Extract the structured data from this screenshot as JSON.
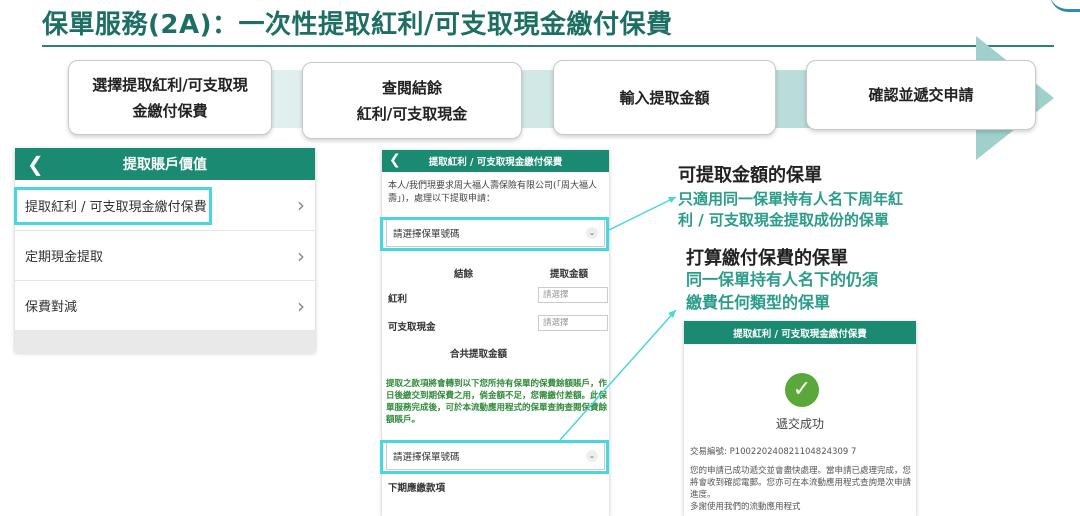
{
  "title": "保單服務(2A)：一次性提取紅利/可支取現金繳付保費",
  "steps": [
    {
      "line1": "選擇提取紅利/可支取現",
      "line2": "金繳付保費"
    },
    {
      "line1": "查閱結餘",
      "line2": "紅利/可支取現金"
    },
    {
      "line1": "輸入提取金額",
      "line2": ""
    },
    {
      "line1": "確認並遞交申請",
      "line2": ""
    }
  ],
  "panel1": {
    "header": "提取賬戶價值",
    "items": [
      "提取紅利 / 可支取現金繳付保費",
      "定期現金提取",
      "保費對減"
    ]
  },
  "panel2": {
    "header": "提取紅利 / 可支取現金繳付保費",
    "intro": "本人/我們現要求周大福人壽保險有限公司(「周大福人壽」)，處理以下提取申請：",
    "policy_select_placeholder": "請選擇保單號碼",
    "col_balance": "結餘",
    "col_amount": "提取金額",
    "row_bonus": "紅利",
    "row_cash": "可支取現金",
    "input_placeholder": "請選擇",
    "total_label": "合共提取金額",
    "note": "提取之款項將會轉到以下您所持有保單的保費餘額賬戶，作日後繳交到期保費之用，倘金額不足，您需繳付差額。此保單服務完成後，可於本流動應用程式的保單查詢查閱保費餘額賬戶。",
    "policy_select2_placeholder": "請選擇保單號碼",
    "next_due": "下期應繳款項"
  },
  "annotation1": {
    "title": "可提取金額的保單",
    "line1": "只適用同一保單持有人名下周年紅",
    "line2": "利 / 可支取現金提取成份的保單"
  },
  "annotation2": {
    "title": "打算繳付保費的保單",
    "line1": "同一保單持有人名下的仍須",
    "line2": "繳費任何類型的保單"
  },
  "panel3": {
    "header": "提取紅利 / 可支取現金繳付保費",
    "success": "遞交成功",
    "txn": "交易編號: P100220240821104824309 7",
    "message": "您的申請已成功遞交並會盡快處理。當申請已處理完成，您將會收到確認電郵。您亦可在本流動應用程式查詢是次申請進度。",
    "message_tail": "多謝使用我們的流動應用程式"
  },
  "colors": {
    "brand": "#1a8a72",
    "highlight": "#4ad6df",
    "accent_text": "#2a9c89",
    "title": "#1e6f63"
  }
}
